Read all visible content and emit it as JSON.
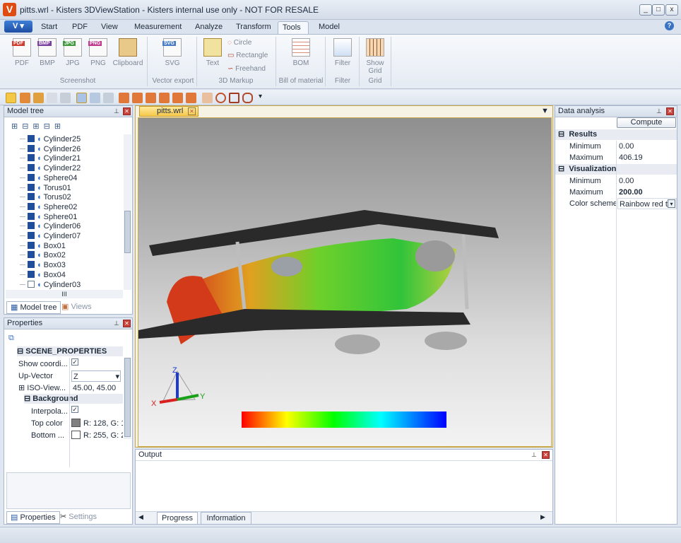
{
  "window": {
    "title": "pitts.wrl - Kisters 3DViewStation - Kisters internal use only - NOT FOR RESALE",
    "app_icon": "V",
    "buttons": [
      "_",
      "□",
      "x"
    ]
  },
  "menu": {
    "app_label": "V",
    "tabs": [
      "Start",
      "PDF",
      "View",
      "Measurement",
      "Analyze",
      "Transform",
      "Tools",
      "Model"
    ],
    "active_tab": "Tools"
  },
  "ribbon": {
    "screenshot": {
      "buttons": [
        "PDF",
        "BMP",
        "JPG",
        "PNG",
        "Clipboard"
      ],
      "group": "Screenshot"
    },
    "vector": {
      "buttons": [
        "SVG"
      ],
      "group": "Vector export"
    },
    "markup": {
      "text": "Text",
      "circle": "Circle",
      "rectangle": "Rectangle",
      "freehand": "Freehand",
      "group": "3D Markup"
    },
    "bom": {
      "buttons": [
        "BOM"
      ],
      "group": "Bill of material"
    },
    "filter": {
      "buttons": [
        "Filter"
      ],
      "group": "Filter"
    },
    "grid": {
      "button_line1": "Show",
      "button_line2": "Grid",
      "group": "Grid"
    },
    "icon_labels": {
      "pdf": "PDF",
      "bmp": "BMP",
      "jpg": "JPG",
      "png": "PNG",
      "svg": "SVG"
    }
  },
  "model_tree": {
    "title": "Model tree",
    "scroll_thumb": "III",
    "items": [
      {
        "label": "Cylinder25",
        "checked": true
      },
      {
        "label": "Cylinder26",
        "checked": true
      },
      {
        "label": "Cylinder21",
        "checked": true
      },
      {
        "label": "Cylinder22",
        "checked": true
      },
      {
        "label": "Sphere04",
        "checked": true
      },
      {
        "label": "Torus01",
        "checked": true
      },
      {
        "label": "Torus02",
        "checked": true
      },
      {
        "label": "Sphere02",
        "checked": true
      },
      {
        "label": "Sphere01",
        "checked": true
      },
      {
        "label": "Cylinder06",
        "checked": true
      },
      {
        "label": "Cylinder07",
        "checked": true
      },
      {
        "label": "Box01",
        "checked": true
      },
      {
        "label": "Box02",
        "checked": true
      },
      {
        "label": "Box03",
        "checked": true
      },
      {
        "label": "Box04",
        "checked": true
      },
      {
        "label": "Cylinder03",
        "checked": false
      }
    ],
    "tabs": [
      "Model tree",
      "Views"
    ]
  },
  "properties": {
    "title": "Properties",
    "section": "SCENE_PROPERTIES",
    "rows": [
      {
        "name": "Show coordi...",
        "value": "✓"
      },
      {
        "name": "Up-Vector",
        "value": "Z"
      },
      {
        "name": "ISO-View...",
        "value": "45.00, 45.00"
      }
    ],
    "background_section": "Background",
    "bg_rows": [
      {
        "name": "Interpola...",
        "value": "✓"
      },
      {
        "name": "Top color",
        "value": "R: 128, G: 12"
      },
      {
        "name": "Bottom ...",
        "value": "R: 255, G: 25"
      }
    ],
    "tabs": [
      "Properties",
      "Settings"
    ],
    "colors": {
      "top": "#808080",
      "bottom": "#ffffff"
    }
  },
  "document": {
    "tab": "pitts.wrl",
    "axes": {
      "x": "X",
      "y": "Y",
      "z": "Z"
    }
  },
  "data_analysis": {
    "title": "Data analysis",
    "compute": "Compute",
    "results": {
      "label": "Results",
      "minimum_label": "Minimum",
      "minimum": "0.00",
      "maximum_label": "Maximum",
      "maximum": "406.19"
    },
    "visualization": {
      "label": "Visualization",
      "minimum_label": "Minimum",
      "minimum": "0.00",
      "maximum_label": "Maximum",
      "maximum": "200.00",
      "scheme_label": "Color scheme",
      "scheme": "Rainbow red to"
    }
  },
  "output": {
    "title": "Output",
    "tabs": [
      "Progress",
      "Information"
    ]
  }
}
